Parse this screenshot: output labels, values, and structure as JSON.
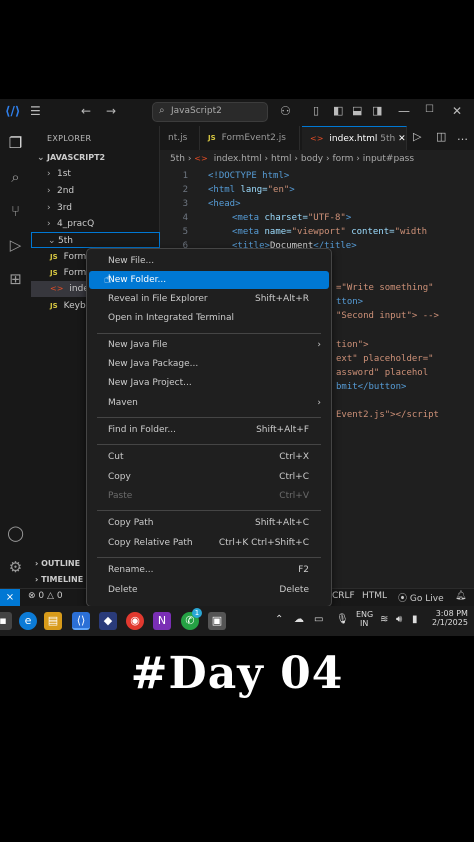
{
  "titlebar": {
    "search": "JavaScript2"
  },
  "explorer": {
    "header": "EXPLORER",
    "workspace": "JAVASCRIPT2",
    "folders": [
      "1st",
      "2nd",
      "3rd",
      "4_pracQ",
      "5th"
    ],
    "files": [
      "Form",
      "Form",
      "index",
      "Keyb"
    ],
    "badges": {
      "js": "JS",
      "html": "<>"
    }
  },
  "tabs": [
    "nt.js",
    "FormEvent2.js",
    "index.html"
  ],
  "tab_folder": "5th",
  "breadcrumb": [
    "5th",
    "index.html",
    "html",
    "body",
    "form",
    "input#pass"
  ],
  "code": {
    "line_numbers": [
      "1",
      "2",
      "3",
      "4",
      "5",
      "6"
    ],
    "l1": "<!DOCTYPE html>",
    "l2_tag": "<html",
    "l2_attr": " lang=",
    "l2_val": "\"en\"",
    "l2_end": ">",
    "l3": "<head>",
    "l4_tag": "<meta",
    "l4_attr": " charset=",
    "l4_val": "\"UTF-8\"",
    "l4_end": ">",
    "l5_tag": "<meta",
    "l5_attr": " name=",
    "l5_val": "\"viewport\"",
    "l5_attr2": " content=",
    "l5_val2": "\"width",
    "l6_tag": "<title>",
    "l6_txt": "Document",
    "l6_end": "</title>",
    "frag1": "=\"Write something\"",
    "frag2": "tton>",
    "frag3": "\"Second input\"> -->",
    "frag4": "tion\">",
    "frag5": "ext\" placeholder=\"",
    "frag6": "assword\" placehol",
    "frag7": "bmit</button>",
    "frag8": "Event2.js\"></script"
  },
  "panels": [
    "OUTLINE",
    "TIMELINE"
  ],
  "statusbar": {
    "errors": "0",
    "warnings": "0",
    "eol": "CRLF",
    "lang": "HTML",
    "golive": "Go Live"
  },
  "context_menu": [
    {
      "label": "New File...",
      "shortcut": ""
    },
    {
      "label": "New Folder...",
      "shortcut": "",
      "highlight": true
    },
    {
      "label": "Reveal in File Explorer",
      "shortcut": "Shift+Alt+R"
    },
    {
      "label": "Open in Integrated Terminal",
      "shortcut": ""
    },
    {
      "label": "New Java File",
      "shortcut": ""
    },
    {
      "label": "New Java Package...",
      "shortcut": ""
    },
    {
      "label": "New Java Project...",
      "shortcut": ""
    },
    {
      "label": "Maven",
      "shortcut": ""
    },
    {
      "label": "Find in Folder...",
      "shortcut": "Shift+Alt+F"
    },
    {
      "label": "Cut",
      "shortcut": "Ctrl+X"
    },
    {
      "label": "Copy",
      "shortcut": "Ctrl+C"
    },
    {
      "label": "Paste",
      "shortcut": "Ctrl+V",
      "disabled": true
    },
    {
      "label": "Copy Path",
      "shortcut": "Shift+Alt+C"
    },
    {
      "label": "Copy Relative Path",
      "shortcut": "Ctrl+K Ctrl+Shift+C"
    },
    {
      "label": "Rename...",
      "shortcut": "F2"
    },
    {
      "label": "Delete",
      "shortcut": "Delete"
    }
  ],
  "taskbar": {
    "lang": "ENG",
    "region": "IN",
    "time": "3:08 PM",
    "date": "2/1/2025",
    "notify": "1"
  },
  "day_title": "#Day 04",
  "colors": {
    "accent": "#0078d4",
    "editor_bg": "#1f1f1f",
    "sidebar_bg": "#181818"
  }
}
